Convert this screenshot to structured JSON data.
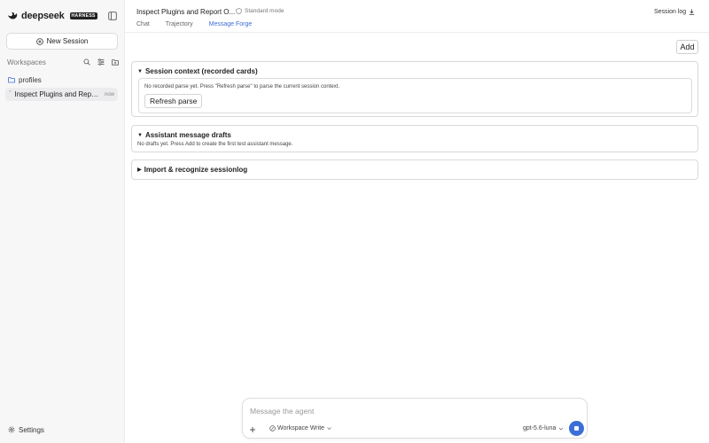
{
  "colors": {
    "accent": "#3b6fd6",
    "sidebar_bg": "#f7f7f8",
    "active_row": "#ececee"
  },
  "sidebar": {
    "brand": "deepseek",
    "brand_badge": "HARNESS",
    "new_session_label": "New Session",
    "workspaces_label": "Workspaces",
    "workspace_icons": [
      "search-icon",
      "filter-icon",
      "new-folder-icon"
    ],
    "folder_label": "profiles",
    "session": {
      "title": "Inspect Plugins and Report Output",
      "time": "now"
    },
    "settings_label": "Settings"
  },
  "header": {
    "title": "Inspect Plugins and Report O...",
    "mode": "Standard mode",
    "session_log_label": "Session log",
    "tabs": [
      {
        "label": "Chat",
        "active": false
      },
      {
        "label": "Trajectory",
        "active": false
      },
      {
        "label": "Message Forge",
        "active": true
      }
    ]
  },
  "main": {
    "add_label": "Add",
    "panels": {
      "session_context": {
        "summary": "Session context (recorded cards)",
        "expanded": true,
        "note": "No recorded parse yet. Press \"Refresh parse\" to parse the current session context.",
        "refresh_label": "Refresh parse"
      },
      "assistant_drafts": {
        "summary": "Assistant message drafts",
        "expanded": true,
        "note": "No drafts yet. Press Add to create the first test assistant message."
      },
      "import": {
        "summary": "Import & recognize sessionlog",
        "expanded": false
      }
    }
  },
  "composer": {
    "placeholder": "Message the agent",
    "value": "",
    "workspace_mode": "Workspace Write",
    "model": "gpt-5.6-luna"
  }
}
